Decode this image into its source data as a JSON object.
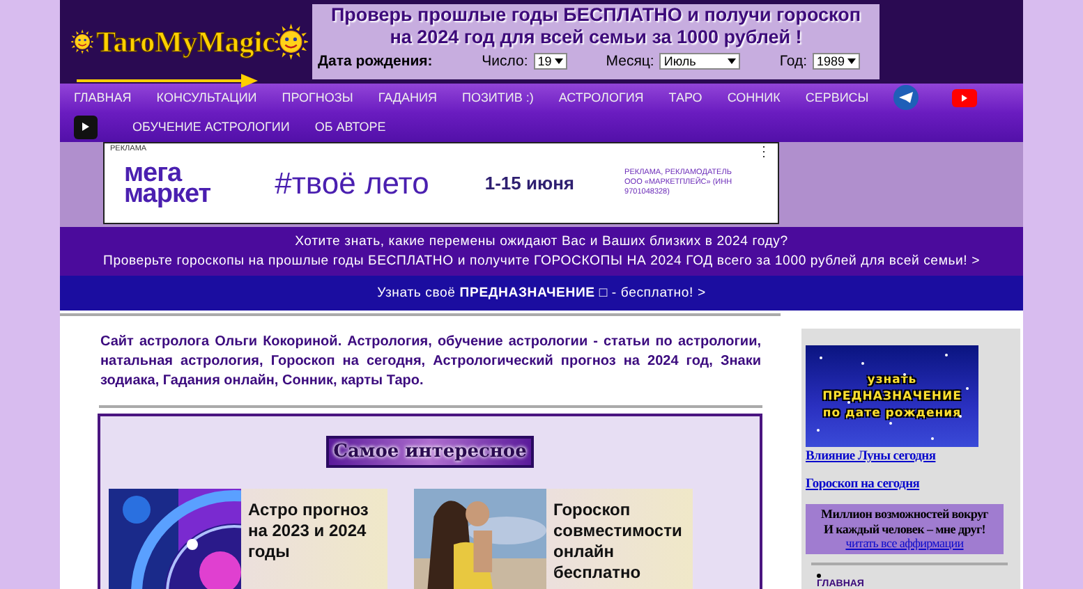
{
  "header": {
    "logo": "TaroMyMagic",
    "promo_lines": [
      "Проверь прошлые годы БЕСПЛАТНО и получи гороскоп",
      "на 2024 год для всей семьи за 1000 рублей !"
    ],
    "birth_form": {
      "label": "Дата рождения:",
      "fields": [
        {
          "label": "Число:",
          "value": "19",
          "kind": "day"
        },
        {
          "label": "Месяц:",
          "value": "Июль",
          "kind": "month"
        },
        {
          "label": "Год:",
          "value": "1989",
          "kind": "year"
        }
      ]
    }
  },
  "nav": {
    "rows": [
      [
        {
          "kind": "link",
          "label": "ГЛАВНАЯ"
        },
        {
          "kind": "link",
          "label": "КОНСУЛЬТАЦИИ"
        },
        {
          "kind": "link",
          "label": "ПРОГНОЗЫ"
        },
        {
          "kind": "link",
          "label": "ГАДАНИЯ"
        },
        {
          "kind": "link",
          "label": "ПОЗИТИВ :)"
        },
        {
          "kind": "link",
          "label": "АСТРОЛОГИЯ"
        },
        {
          "kind": "link",
          "label": "ТАРО"
        },
        {
          "kind": "link",
          "label": "СОННИК"
        },
        {
          "kind": "link",
          "label": "СЕРВИСЫ"
        },
        {
          "kind": "telegram"
        },
        {
          "kind": "youtube"
        }
      ],
      [
        {
          "kind": "video"
        },
        {
          "kind": "link",
          "label": "ОБУЧЕНИЕ АСТРОЛОГИИ"
        },
        {
          "kind": "link",
          "label": "ОБ АВТОРЕ"
        }
      ]
    ]
  },
  "ad": {
    "label": "РЕКЛАМА",
    "brand_lines": [
      "мега",
      "маркет"
    ],
    "slogan": "#твоё лето",
    "dates": "1-15 июня",
    "disclaimer": "РЕКЛАМА, РЕКЛАМОДАТЕЛЬ ООО «МАРКЕТПЛЕЙС» (ИНН 9701048328)",
    "menu": "⋮"
  },
  "promo_banner": {
    "lines": [
      "Хотите знать, какие перемены ожидают Вас и Ваших близких в 2024 году?",
      "Проверьте гороскопы на прошлые годы БЕСПЛАТНО и получите ГОРОСКОПЫ НА 2024 ГОД всего за 1000 рублей для всей семьи! >"
    ]
  },
  "destiny_link": "Узнать своё **ПРЕДНАЗНАЧЕНИЕ** □ - бесплатно! >",
  "intro": "Сайт астролога Ольги Кокориной. Астрология, обучение астрологии - статьи по астрологии, натальная астрология, Гороскоп на сегодня, Астрологический прогноз на 2024 год, Знаки зодиака, Гадания онлайн, Сонник, карты Таро.",
  "featured": {
    "title": "Самое интересное",
    "cards": [
      {
        "kind": "zodiac",
        "text": "Астро прогноз на 2023 и 2024 годы"
      },
      {
        "kind": "couple",
        "text": "Гороскоп совместимости онлайн бесплатно"
      }
    ]
  },
  "sidebar": {
    "banner_lines": [
      "узнать",
      "ПРЕДНАЗНАЧЕНИЕ",
      "по дате рождения"
    ],
    "links": [
      "Влияние Луны сегодня",
      "Гороскоп на сегодня"
    ],
    "affirmation": {
      "lines": [
        "Миллион возможностей вокруг",
        "И каждый человек – мне друг!"
      ],
      "link": "читать все аффирмации"
    },
    "menu_items": [
      "ГЛАВНАЯ"
    ]
  }
}
